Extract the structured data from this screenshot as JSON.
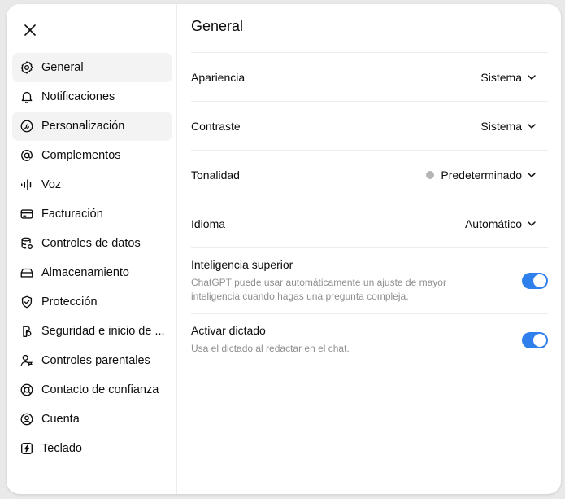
{
  "window": {
    "close_label": ""
  },
  "sidebar": {
    "items": [
      {
        "label": "General",
        "icon": "gear-icon",
        "active": true
      },
      {
        "label": "Notificaciones",
        "icon": "bell-icon"
      },
      {
        "label": "Personalización",
        "icon": "personalization-icon",
        "hover": true
      },
      {
        "label": "Complementos",
        "icon": "at-sign-icon"
      },
      {
        "label": "Voz",
        "icon": "waveform-icon"
      },
      {
        "label": "Facturación",
        "icon": "credit-card-icon"
      },
      {
        "label": "Controles de datos",
        "icon": "database-icon"
      },
      {
        "label": "Almacenamiento",
        "icon": "storage-icon"
      },
      {
        "label": "Protección",
        "icon": "shield-icon"
      },
      {
        "label": "Seguridad e inicio de ...",
        "icon": "lock-key-icon"
      },
      {
        "label": "Controles parentales",
        "icon": "parent-user-icon"
      },
      {
        "label": "Contacto de confianza",
        "icon": "lifebuoy-icon"
      },
      {
        "label": "Cuenta",
        "icon": "user-circle-icon"
      },
      {
        "label": "Teclado",
        "icon": "lightning-icon"
      }
    ]
  },
  "main": {
    "title": "General",
    "settings": [
      {
        "label": "Apariencia",
        "value": "Sistema"
      },
      {
        "label": "Contraste",
        "value": "Sistema"
      },
      {
        "label": "Tonalidad",
        "value": "Predeterminado",
        "swatch": "#b4b4b4"
      },
      {
        "label": "Idioma",
        "value": "Automático"
      }
    ],
    "toggles": [
      {
        "title": "Inteligencia superior",
        "description": "ChatGPT puede usar automáticamente un ajuste de mayor inteligencia cuando hagas una pregunta compleja.",
        "on": true
      },
      {
        "title": "Activar dictado",
        "description": "Usa el dictado al redactar en el chat.",
        "on": true
      }
    ]
  },
  "colors": {
    "accent": "#2f80ed",
    "active_bg": "#f3f3f3",
    "divider": "#ececec"
  }
}
